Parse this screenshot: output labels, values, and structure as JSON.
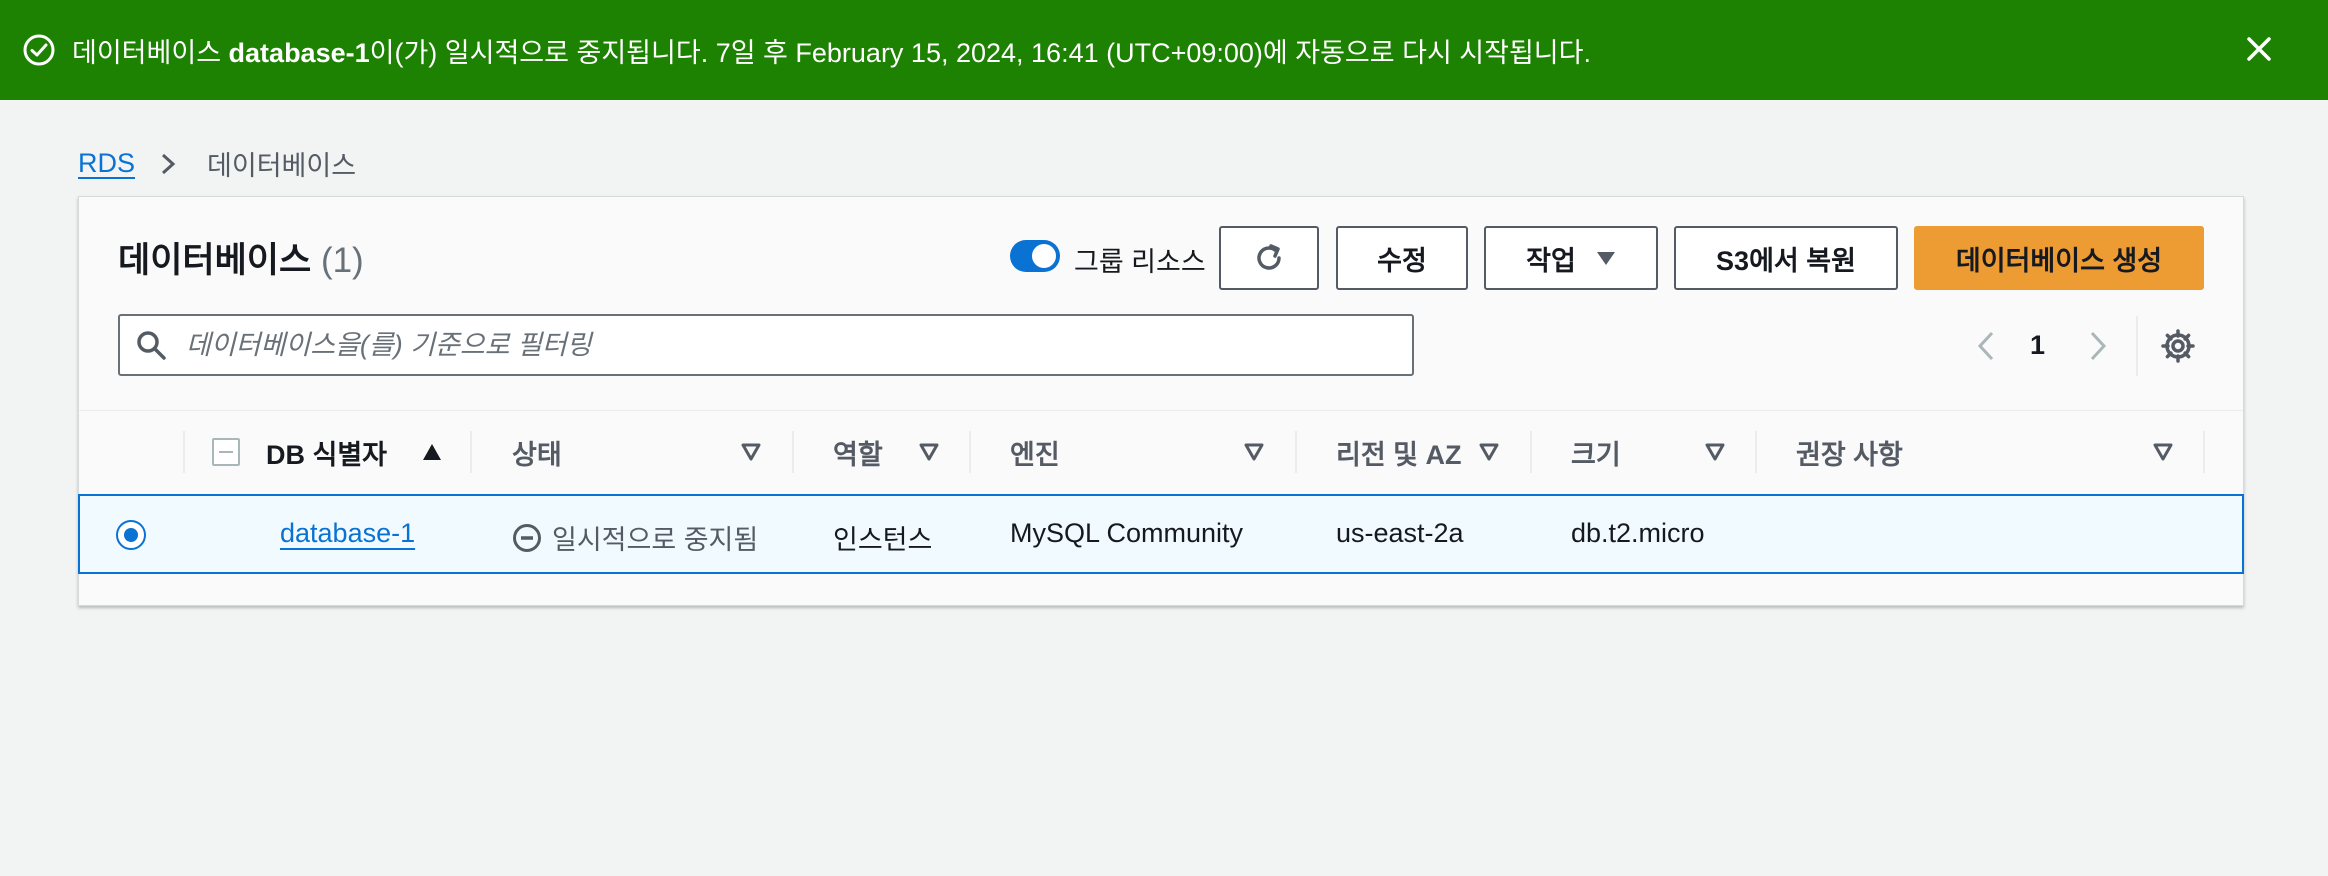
{
  "flash": {
    "icon": "check-circle-icon",
    "message_pre": "데이터베이스 ",
    "message_db": "database-1",
    "message_post": "이(가) 일시적으로 중지됩니다. 7일 후 February 15, 2024, 16:41 (UTC+09:00)에 자동으로 다시 시작됩니다.",
    "close_icon": "close-icon",
    "color": "#1d8102"
  },
  "breadcrumb": {
    "root": "RDS",
    "current": "데이터베이스"
  },
  "panel": {
    "title": "데이터베이스",
    "count": "(1)",
    "group_toggle_label": "그룹 리소스",
    "group_toggle_on": true,
    "refresh_icon": "refresh-icon",
    "modify_label": "수정",
    "actions_label": "작업",
    "restore_s3_label": "S3에서 복원",
    "create_label": "데이터베이스 생성",
    "accent": "#ec9c33"
  },
  "search": {
    "placeholder": "데이터베이스을(를) 기준으로 필터링",
    "value": ""
  },
  "pagination": {
    "current_page": "1"
  },
  "table": {
    "columns": [
      "DB 식별자",
      "상태",
      "역할",
      "엔진",
      "리전 및 AZ",
      "크기",
      "권장 사항"
    ],
    "sorted_column": "DB 식별자",
    "rows": [
      {
        "selected": true,
        "db_identifier": "database-1",
        "status": "일시적으로 중지됨",
        "role": "인스턴스",
        "engine": "MySQL Community",
        "region_az": "us-east-2a",
        "size": "db.t2.micro",
        "recommendations": ""
      }
    ]
  }
}
